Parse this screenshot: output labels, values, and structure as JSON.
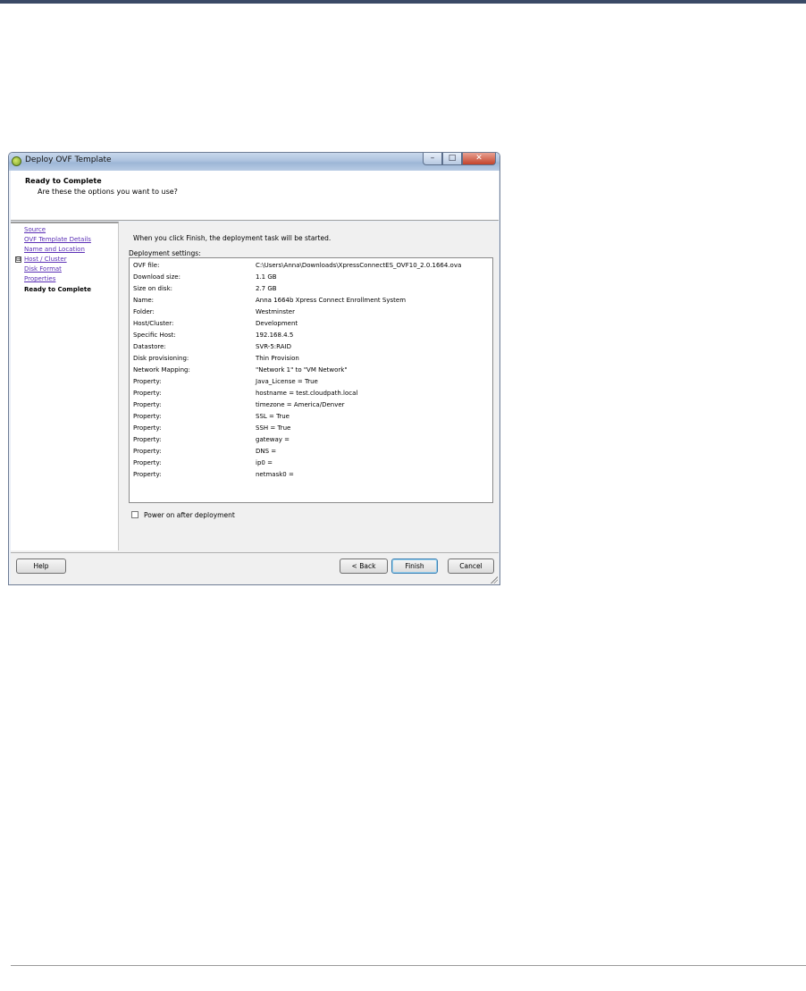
{
  "window": {
    "title": "Deploy OVF Template",
    "buttons": {
      "minimize": "–",
      "maximize": "□",
      "close": "✕"
    }
  },
  "header": {
    "title": "Ready to Complete",
    "subtitle": "Are these the options you want to use?"
  },
  "nav": {
    "items": [
      {
        "label": "Source"
      },
      {
        "label": "OVF Template Details"
      },
      {
        "label": "Name and Location"
      },
      {
        "label": "Host / Cluster",
        "expander": "⊟"
      },
      {
        "label": "Disk Format"
      },
      {
        "label": "Properties"
      },
      {
        "label": "Ready to Complete"
      }
    ]
  },
  "content": {
    "intro": "When you click Finish, the deployment task will be started.",
    "settings_label": "Deployment settings:",
    "settings": [
      {
        "key": "OVF file:",
        "value": "C:\\Users\\Anna\\Downloads\\XpressConnectES_OVF10_2.0.1664.ova"
      },
      {
        "key": "Download size:",
        "value": "1.1 GB"
      },
      {
        "key": "Size on disk:",
        "value": "2.7 GB"
      },
      {
        "key": "Name:",
        "value": "Anna 1664b Xpress Connect Enrollment System"
      },
      {
        "key": "Folder:",
        "value": "Westminster"
      },
      {
        "key": "Host/Cluster:",
        "value": "Development"
      },
      {
        "key": "Specific Host:",
        "value": "192.168.4.5"
      },
      {
        "key": "Datastore:",
        "value": "SVR-5:RAID"
      },
      {
        "key": "Disk provisioning:",
        "value": "Thin Provision"
      },
      {
        "key": "Network Mapping:",
        "value": "\"Network 1\" to \"VM Network\""
      },
      {
        "key": "Property:",
        "value": "Java_License = True"
      },
      {
        "key": "Property:",
        "value": "hostname = test.cloudpath.local"
      },
      {
        "key": "Property:",
        "value": "timezone = America/Denver"
      },
      {
        "key": "Property:",
        "value": "SSL = True"
      },
      {
        "key": "Property:",
        "value": "SSH = True"
      },
      {
        "key": "Property:",
        "value": "gateway ="
      },
      {
        "key": "Property:",
        "value": "DNS ="
      },
      {
        "key": "Property:",
        "value": "ip0 ="
      },
      {
        "key": "Property:",
        "value": "netmask0 ="
      }
    ],
    "power_on_label": "Power on after deployment"
  },
  "footer": {
    "help": "Help",
    "back": "< Back",
    "finish": "Finish",
    "cancel": "Cancel"
  }
}
